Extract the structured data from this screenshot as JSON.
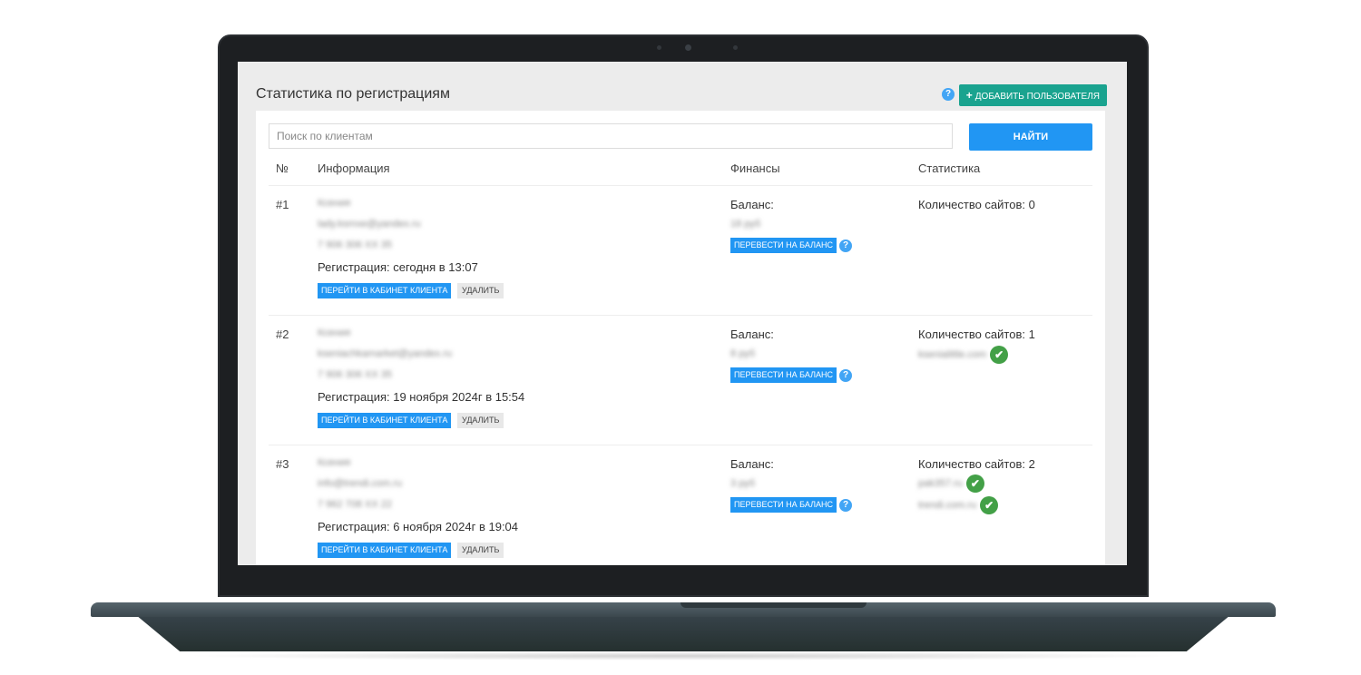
{
  "page": {
    "title": "Статистика по регистрациям",
    "add_user_label": "ДОБАВИТЬ ПОЛЬЗОВАТЕЛЯ",
    "help_glyph": "?"
  },
  "search": {
    "placeholder": "Поиск по клиентам",
    "button_label": "НАЙТИ"
  },
  "table": {
    "headers": {
      "num": "№",
      "info": "Информация",
      "finance": "Финансы",
      "stats": "Статистика"
    },
    "go_label": "ПЕРЕЙТИ В КАБИНЕТ КЛИЕНТА",
    "delete_label": "УДАЛИТЬ",
    "transfer_label": "ПЕРЕВЕСТИ НА БАЛАНС",
    "balance_label": "Баланс:",
    "rows": [
      {
        "num": "#1",
        "name": "Ксения",
        "email": "lady.ksmxe@yandex.ru",
        "phone": "7 906 306 XX 35",
        "registration": "Регистрация: сегодня в 13:07",
        "balance": "18 руб",
        "sites_count": "Количество сайтов: 0",
        "sites": []
      },
      {
        "num": "#2",
        "name": "Ксения",
        "email": "kseniachkamarket@yandex.ru",
        "phone": "7 906 306 XX 35",
        "registration": "Регистрация: 19 ноября 2024г в 15:54",
        "balance": "8 руб",
        "sites_count": "Количество сайтов: 1",
        "sites": [
          "ksenialittle.com"
        ]
      },
      {
        "num": "#3",
        "name": "Ксения",
        "email": "info@trendi.com.ru",
        "phone": "7 962 708 XX 22",
        "registration": "Регистрация: 6 ноября 2024г в 19:04",
        "balance": "3 руб",
        "sites_count": "Количество сайтов: 2",
        "sites": [
          "pak357.ru",
          "trendi.com.ru"
        ]
      }
    ]
  },
  "icons": {
    "check": "✔",
    "plus": "+"
  },
  "colors": {
    "accent_blue": "#2196f3",
    "add_button_teal": "#1aa38f",
    "check_green": "#43a047",
    "help_blue": "#42a5f5"
  }
}
